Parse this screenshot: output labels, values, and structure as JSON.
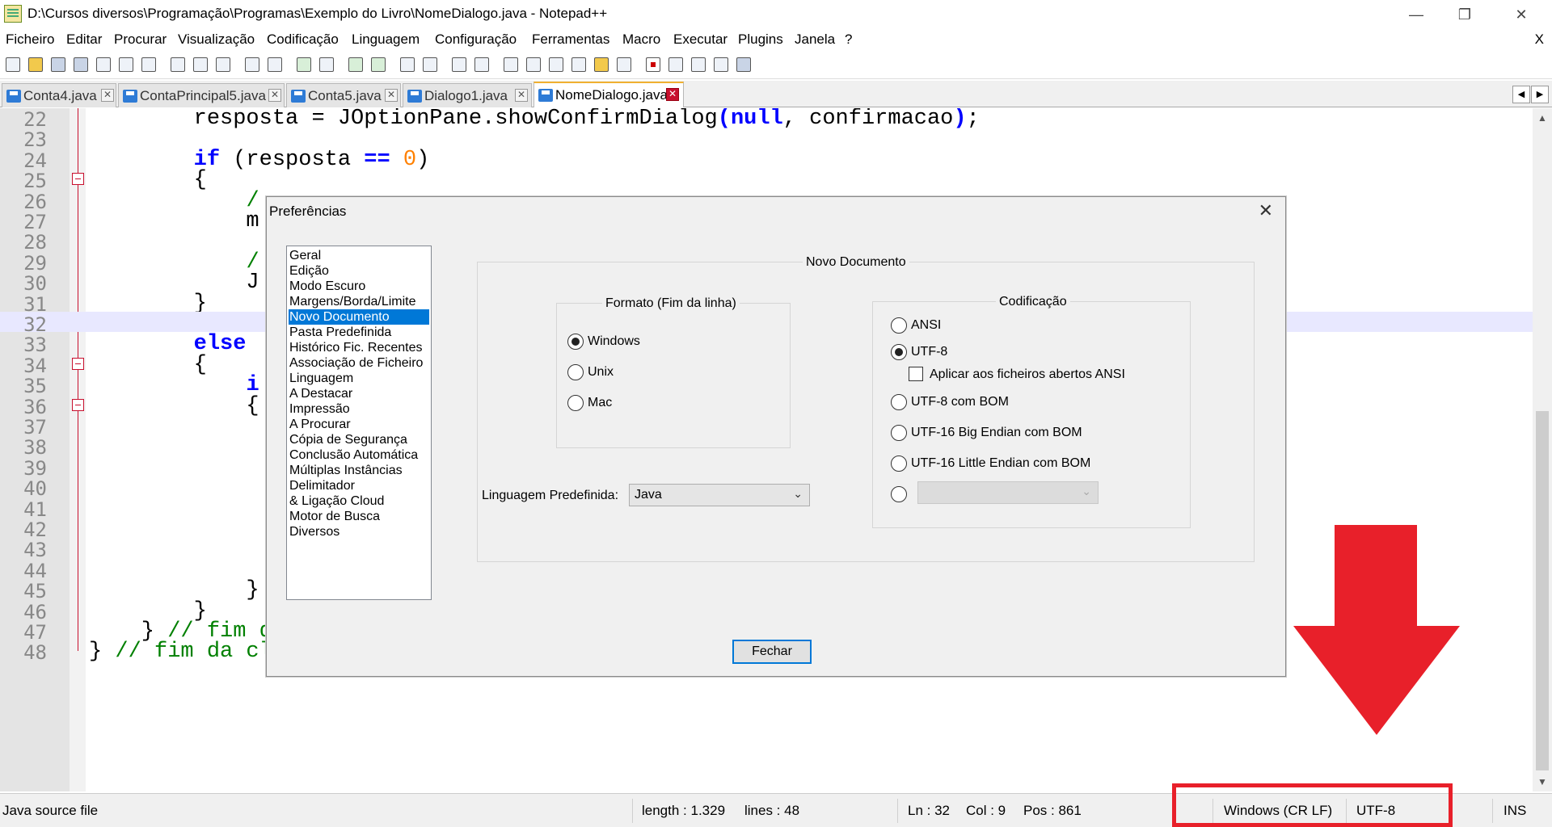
{
  "window": {
    "title": "D:\\Cursos diversos\\Programação\\Programas\\Exemplo do Livro\\NomeDialogo.java - Notepad++",
    "minimize": "—",
    "restore": "❐",
    "close": "✕"
  },
  "menu": {
    "items": [
      "Ficheiro",
      "Editar",
      "Procurar",
      "Visualização",
      "Codificação",
      "Linguagem",
      "Configuração",
      "Ferramentas",
      "Macro",
      "Executar",
      "Plugins",
      "Janela",
      "?"
    ],
    "close": "X"
  },
  "toolbar": {
    "icons": [
      "new-file-icon",
      "open-file-icon",
      "save-icon",
      "save-all-icon",
      "close-icon",
      "close-all-icon",
      "print-icon",
      "cut-icon",
      "copy-icon",
      "paste-icon",
      "undo-icon",
      "redo-icon",
      "find-icon",
      "replace-icon",
      "zoom-in-icon",
      "zoom-out-icon",
      "sync-v-icon",
      "sync-h-icon",
      "word-wrap-icon",
      "show-all-chars-icon",
      "indent-guide-icon",
      "lang-icon",
      "doc-map-icon",
      "function-list-icon",
      "folder-workspace-icon",
      "monitor-icon",
      "record-macro-icon",
      "stop-macro-icon",
      "play-macro-icon",
      "run-macro-multiple-icon",
      "save-macro-icon"
    ]
  },
  "tabs": [
    {
      "label": "Conta4.java",
      "active": false
    },
    {
      "label": "ContaPrincipal5.java",
      "active": false
    },
    {
      "label": "Conta5.java",
      "active": false
    },
    {
      "label": "Dialogo1.java",
      "active": false
    },
    {
      "label": "NomeDialogo.java",
      "active": true
    }
  ],
  "editor": {
    "current_line": "32",
    "lines": [
      {
        "n": "22",
        "segs": [
          [
            "",
            "        resposta = JOptionPane.showConfirmDialog"
          ],
          [
            "kw",
            "("
          ],
          [
            "kw",
            "null"
          ],
          [
            "",
            ", confirmacao"
          ],
          [
            "kw",
            ")"
          ],
          [
            "",
            ";"
          ]
        ]
      },
      {
        "n": "23",
        "segs": []
      },
      {
        "n": "24",
        "segs": [
          [
            "",
            "        "
          ],
          [
            "kw",
            "if"
          ],
          [
            "",
            " (resposta "
          ],
          [
            "kw",
            "=="
          ],
          [
            "",
            " "
          ],
          [
            "num",
            "0"
          ],
          [
            "",
            ")"
          ]
        ]
      },
      {
        "n": "25",
        "segs": [
          [
            "",
            "        {"
          ]
        ]
      },
      {
        "n": "26",
        "segs": [
          [
            "",
            "            "
          ],
          [
            "cm",
            "/"
          ]
        ]
      },
      {
        "n": "27",
        "segs": [
          [
            "",
            "            m"
          ]
        ]
      },
      {
        "n": "28",
        "segs": []
      },
      {
        "n": "29",
        "segs": [
          [
            "",
            "            "
          ],
          [
            "cm",
            "/"
          ]
        ]
      },
      {
        "n": "30",
        "segs": [
          [
            "",
            "            J"
          ]
        ]
      },
      {
        "n": "31",
        "segs": [
          [
            "",
            "        }"
          ]
        ]
      },
      {
        "n": "32",
        "segs": []
      },
      {
        "n": "33",
        "segs": [
          [
            "",
            "        "
          ],
          [
            "kw",
            "else"
          ]
        ]
      },
      {
        "n": "34",
        "segs": [
          [
            "",
            "        {"
          ]
        ]
      },
      {
        "n": "35",
        "segs": [
          [
            "",
            "            "
          ],
          [
            "kw",
            "i"
          ]
        ]
      },
      {
        "n": "36",
        "segs": [
          [
            "",
            "            {"
          ]
        ]
      },
      {
        "n": "37",
        "segs": []
      },
      {
        "n": "38",
        "segs": []
      },
      {
        "n": "39",
        "segs": []
      },
      {
        "n": "40",
        "segs": []
      },
      {
        "n": "41",
        "segs": []
      },
      {
        "n": "42",
        "segs": []
      },
      {
        "n": "43",
        "segs": []
      },
      {
        "n": "44",
        "segs": []
      },
      {
        "n": "45",
        "segs": [
          [
            "",
            "            }"
          ]
        ]
      },
      {
        "n": "46",
        "segs": [
          [
            "",
            "        }"
          ]
        ]
      },
      {
        "n": "47",
        "segs": [
          [
            "",
            "    } "
          ],
          [
            "cm",
            "// fim do método main"
          ]
        ]
      },
      {
        "n": "48",
        "segs": [
          [
            "",
            "} "
          ],
          [
            "cm",
            "// fim da classe NomeDialogo"
          ]
        ]
      }
    ]
  },
  "dialog": {
    "title": "Preferências",
    "close": "✕",
    "categories": [
      "Geral",
      "Edição",
      "Modo Escuro",
      "Margens/Borda/Limite",
      "Novo Documento",
      "Pasta Predefinida",
      "Histórico Fic. Recentes",
      "Associação de Ficheiro",
      "Linguagem",
      "A Destacar",
      "Impressão",
      "A Procurar",
      "Cópia de Segurança",
      "Conclusão Automática",
      "Múltiplas Instâncias",
      "Delimitador",
      "& Ligação Cloud",
      "Motor de Busca",
      "Diversos"
    ],
    "selected_category": "Novo Documento",
    "section_title": "Novo Documento",
    "format": {
      "label": "Formato (Fim da linha)",
      "options": [
        {
          "label": "Windows",
          "checked": true
        },
        {
          "label": "Unix",
          "checked": false
        },
        {
          "label": "Mac",
          "checked": false
        }
      ]
    },
    "encoding": {
      "label": "Codificação",
      "ansi": "ANSI",
      "utf8": "UTF-8",
      "apply_ansi": "Aplicar aos ficheiros abertos ANSI",
      "utf8_bom": "UTF-8 com BOM",
      "utf16_be": "UTF-16 Big Endian com BOM",
      "utf16_le": "UTF-16 Little Endian com BOM",
      "selected": "UTF-8"
    },
    "default_language": {
      "label": "Linguagem Predefinida:",
      "value": "Java"
    },
    "close_button": "Fechar"
  },
  "status": {
    "file_type": "Java source file",
    "length": "length : 1.329",
    "lines": "lines : 48",
    "ln": "Ln : 32",
    "col": "Col : 9",
    "pos": "Pos : 861",
    "eol": "Windows (CR LF)",
    "encoding": "UTF-8",
    "mode": "INS"
  },
  "annotation_color": "#e8202a"
}
